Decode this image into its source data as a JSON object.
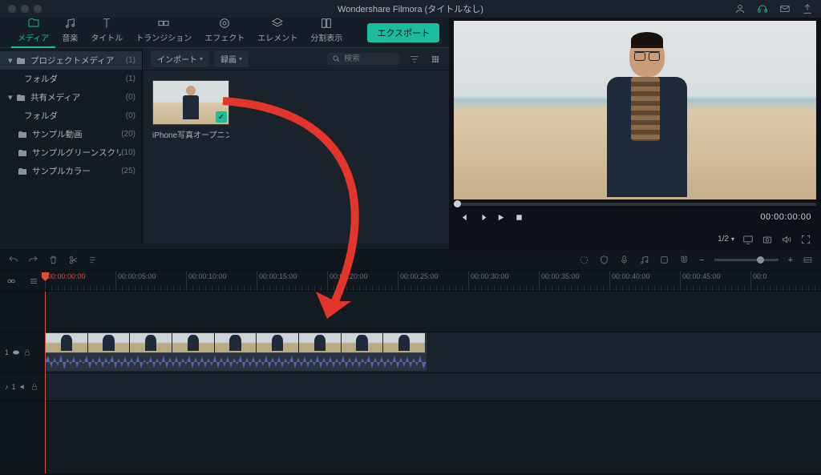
{
  "app_title": "Wondershare Filmora (タイトルなし)",
  "tabs": [
    {
      "id": "media",
      "label": "メディア"
    },
    {
      "id": "audio",
      "label": "音楽"
    },
    {
      "id": "title",
      "label": "タイトル"
    },
    {
      "id": "transition",
      "label": "トランジション"
    },
    {
      "id": "effect",
      "label": "エフェクト"
    },
    {
      "id": "element",
      "label": "エレメント"
    },
    {
      "id": "split",
      "label": "分割表示"
    }
  ],
  "export_label": "エクスポート",
  "sidebar": [
    {
      "label": "プロジェクトメディア",
      "count": "(1)",
      "kind": "root-sel"
    },
    {
      "label": "フォルダ",
      "count": "(1)",
      "kind": "sub"
    },
    {
      "label": "共有メディア",
      "count": "(0)",
      "kind": "root"
    },
    {
      "label": "フォルダ",
      "count": "(0)",
      "kind": "sub"
    },
    {
      "label": "サンプル動画",
      "count": "(20)",
      "kind": "child"
    },
    {
      "label": "サンプルグリーンスクリーン",
      "count": "(10)",
      "kind": "child"
    },
    {
      "label": "サンプルカラー",
      "count": "(25)",
      "kind": "child"
    }
  ],
  "media_toolbar": {
    "import_label": "インポート",
    "record_label": "録画",
    "search_placeholder": "検索"
  },
  "clip": {
    "name": "iPhone写真オープニング"
  },
  "preview": {
    "time": "00:00:00:00",
    "zoom_label": "1/2"
  },
  "ruler": [
    "00:00:00:00",
    "00:00:05:00",
    "00:00:10:00",
    "00:00:15:00",
    "00:00:20:00",
    "00:00:25:00",
    "00:00:30:00",
    "00:00:35:00",
    "00:00:40:00",
    "00:00:45:00",
    "00:0"
  ],
  "tracks": {
    "video_label": "1",
    "audio_label": "1"
  }
}
